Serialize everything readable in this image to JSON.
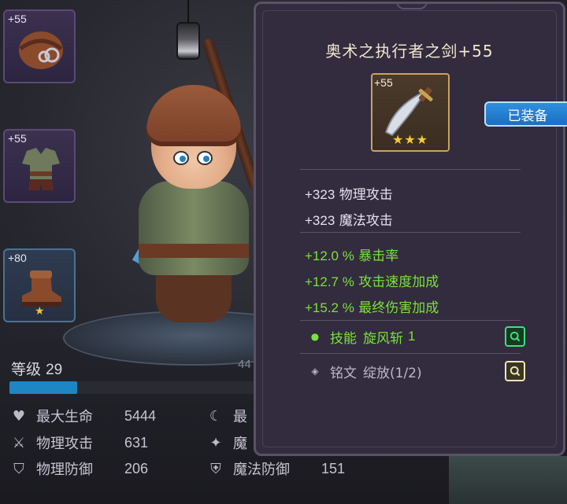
{
  "item": {
    "title": "奥术之执行者之剑+55",
    "enhance": "+55",
    "stars": "★★★",
    "equipped_label": "已装备",
    "base_attrs": [
      {
        "value": "+323",
        "name": "物理攻击"
      },
      {
        "value": "+323",
        "name": "魔法攻击"
      }
    ],
    "bonus_attrs": [
      {
        "value": "+12.0 %",
        "name": "暴击率"
      },
      {
        "value": "+12.7 %",
        "name": "攻击速度加成"
      },
      {
        "value": "+15.2 %",
        "name": "最终伤害加成"
      }
    ],
    "skill": {
      "label": "技能",
      "name": "旋风斩",
      "level": "1"
    },
    "rune": {
      "label": "铭文",
      "name": "绽放(1/2)"
    }
  },
  "slots": [
    {
      "name": "helmet",
      "enhance": "+55"
    },
    {
      "name": "armor",
      "enhance": "+55"
    },
    {
      "name": "boots",
      "enhance": "+80",
      "stars": "★"
    }
  ],
  "level": {
    "label": "等级",
    "value": "29",
    "right_partial": "44",
    "progress": 0.27
  },
  "stats_left": [
    {
      "icon": "heart-icon",
      "glyph": "♥",
      "label": "最大生命",
      "value": "5444"
    },
    {
      "icon": "sword-icon",
      "glyph": "⚔",
      "label": "物理攻击",
      "value": "631"
    },
    {
      "icon": "shield-icon",
      "glyph": "⛉",
      "label": "物理防御",
      "value": "206"
    }
  ],
  "stats_right": [
    {
      "icon": "moon-icon",
      "glyph": "☾",
      "label": "最",
      "value": ""
    },
    {
      "icon": "magic-icon",
      "glyph": "✦",
      "label": "魔",
      "value": ""
    },
    {
      "icon": "magic-shield-icon",
      "glyph": "⛨",
      "label": "魔法防御",
      "value": "151"
    }
  ],
  "colors": {
    "equipped": "#1f7fd0",
    "bonus": "#78e33a",
    "xp": "#1f86c4",
    "panel": "#332b3e"
  }
}
